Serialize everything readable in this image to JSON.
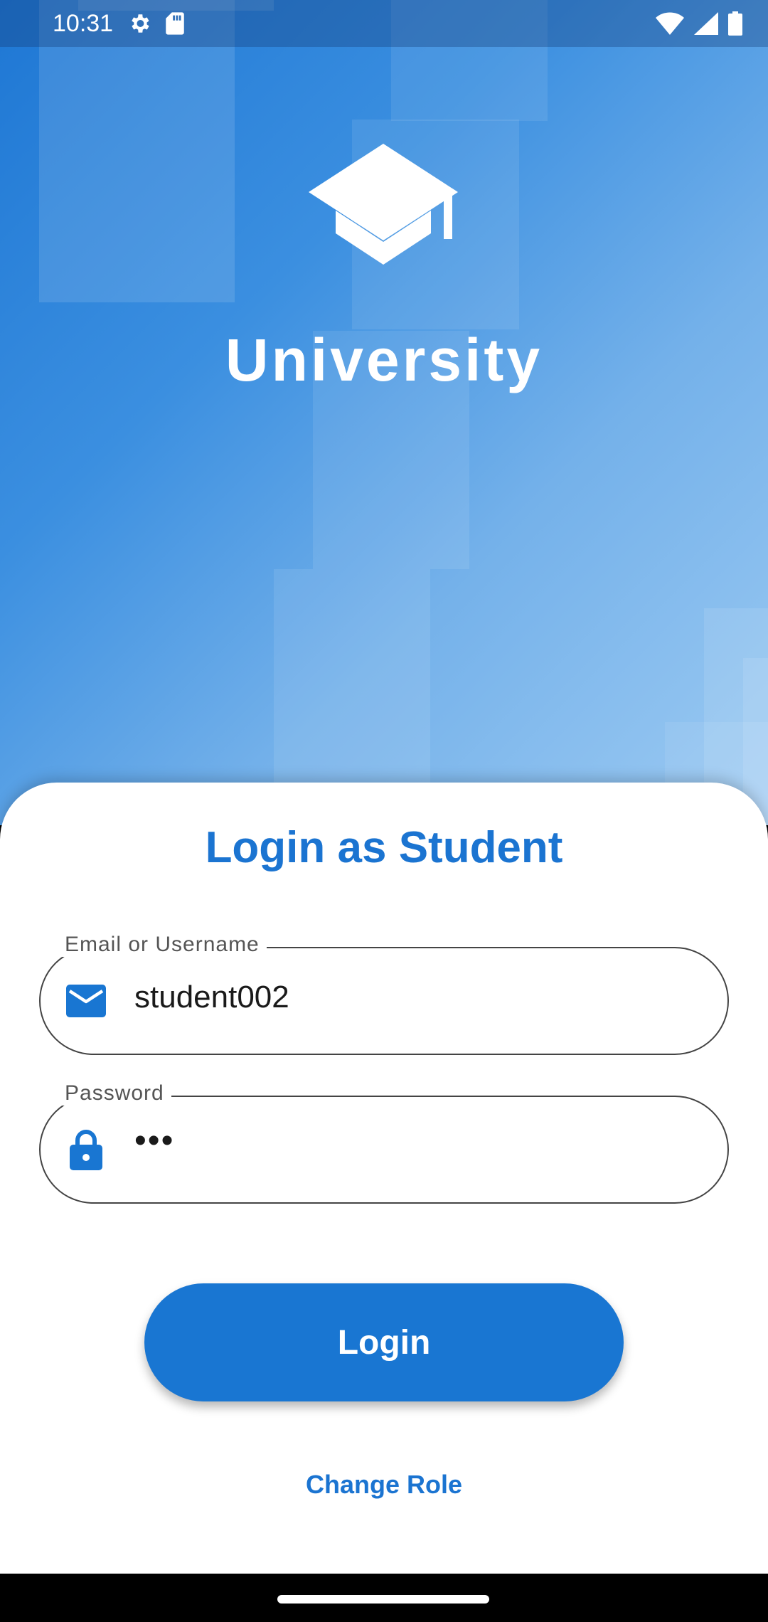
{
  "status_bar": {
    "time": "10:31",
    "icons": [
      "gear-icon",
      "sd-card-icon",
      "wifi-icon",
      "signal-icon",
      "battery-icon"
    ]
  },
  "brand": {
    "logo_icon": "graduation-cap-icon",
    "name": "University"
  },
  "login": {
    "title": "Login as Student",
    "email_field": {
      "label": "Email or Username",
      "value": "student002",
      "icon": "email-icon"
    },
    "password_field": {
      "label": "Password",
      "value": "•••",
      "icon": "lock-icon"
    },
    "login_button": "Login",
    "change_role_link": "Change Role"
  },
  "colors": {
    "primary": "#1976d2",
    "title": "#1b74d1",
    "hero_start": "#1e77d4",
    "hero_end": "#9ccaf2"
  }
}
